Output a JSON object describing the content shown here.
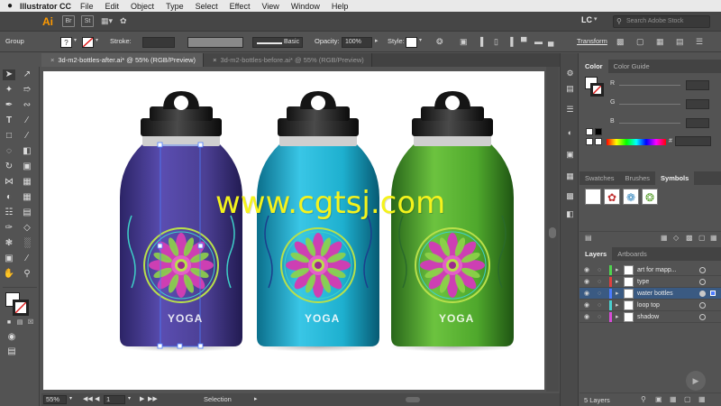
{
  "menubar": {
    "apple": "",
    "app_name": "Illustrator CC",
    "items": [
      "File",
      "Edit",
      "Object",
      "Type",
      "Select",
      "Effect",
      "View",
      "Window",
      "Help"
    ]
  },
  "appbar": {
    "logo": "Ai",
    "bridge": "Br",
    "stock": "St",
    "workspace": "LC",
    "search_placeholder": "Search Adobe Stock"
  },
  "control": {
    "selection": "Group",
    "stroke_label": "Stroke:",
    "brush_label": "Basic",
    "opacity_label": "Opacity:",
    "opacity_value": "100%",
    "style_label": "Style:",
    "transform_label": "Transform"
  },
  "tabs": [
    {
      "label": "3d-m2-bottles-after.ai* @ 55% (RGB/Preview)",
      "active": true
    },
    {
      "label": "3d-m2-bottles-before.ai* @ 55% (RGB/Preview)",
      "active": false
    }
  ],
  "canvas": {
    "watermark": "www.cgtsj.com",
    "bottles": [
      {
        "label": "YOGA",
        "color": "#4b3f93"
      },
      {
        "label": "YOGA",
        "color": "#1eb0cf"
      },
      {
        "label": "YOGA",
        "color": "#4fa82c"
      }
    ]
  },
  "status": {
    "zoom": "55%",
    "artboard": "1",
    "mode": "Selection"
  },
  "color_panel": {
    "tabs": [
      "Color",
      "Color Guide"
    ],
    "channels": [
      "R",
      "G",
      "B"
    ],
    "hex_label": "#"
  },
  "swatches_panel": {
    "tabs": [
      "Swatches",
      "Brushes",
      "Symbols"
    ]
  },
  "layers_panel": {
    "tabs": [
      "Layers",
      "Artboards"
    ],
    "layers": [
      {
        "name": "art for mapp...",
        "color": "#4fd44f",
        "selected": false
      },
      {
        "name": "type",
        "color": "#e04040",
        "selected": false
      },
      {
        "name": "water bottles",
        "color": "#4c7cff",
        "selected": true
      },
      {
        "name": "loop top",
        "color": "#49d0d0",
        "selected": false
      },
      {
        "name": "shadow",
        "color": "#d84cd8",
        "selected": false
      }
    ],
    "count": "5 Layers"
  }
}
